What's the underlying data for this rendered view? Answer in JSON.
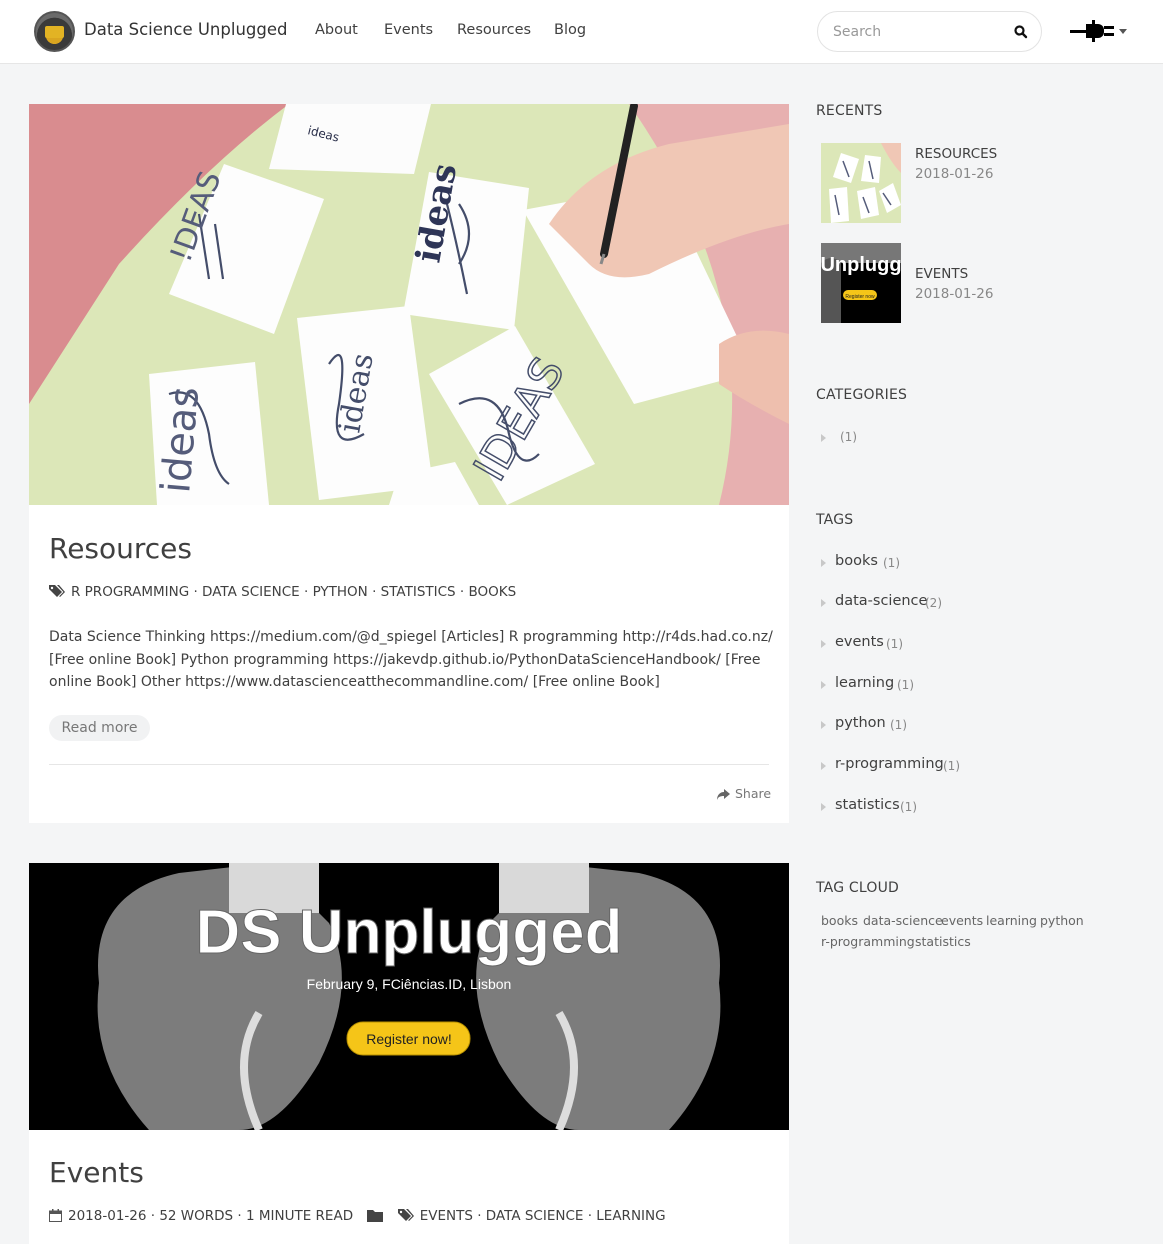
{
  "header": {
    "site_title": "Data Science Unplugged",
    "nav": [
      "About",
      "Events",
      "Resources",
      "Blog"
    ],
    "search_placeholder": "Search"
  },
  "posts": [
    {
      "title": "Resources",
      "tags": "R PROGRAMMING · DATA SCIENCE · PYTHON · STATISTICS · BOOKS",
      "excerpt": "Data Science Thinking https://medium.com/@d_spiegel [Articles] R programming http://r4ds.had.co.nz/ [Free online Book] Python programming https://jakevdp.github.io/PythonDataScienceHandbook/ [Free online Book] Other https://www.datascienceatthecommandline.com/ [Free online Book]",
      "read_more": "Read more",
      "share": "Share",
      "image_words": [
        "ideas",
        "!DEAS",
        "ideas",
        "ideas",
        "ideas",
        "IDEAS"
      ]
    },
    {
      "title": "Events",
      "meta": "2018-01-26 · 52 WORDS · 1 MINUTE READ",
      "tags": "EVENTS · DATA SCIENCE · LEARNING",
      "banner_title": "DS Unplugged",
      "banner_subtitle": "February 9, FCiências.ID, Lisbon",
      "banner_button": "Register now!"
    }
  ],
  "sidebar": {
    "recents_heading": "RECENTS",
    "recents": [
      {
        "title": "RESOURCES",
        "date": "2018-01-26"
      },
      {
        "title": "EVENTS",
        "date": "2018-01-26",
        "thumb_text": "Unplugg",
        "thumb_button": "Register now"
      }
    ],
    "categories_heading": "CATEGORIES",
    "categories": [
      {
        "name": "",
        "count": "(1)"
      }
    ],
    "tags_heading": "TAGS",
    "tags": [
      {
        "name": "books",
        "count": "(1)"
      },
      {
        "name": "data-science",
        "count": "(2)"
      },
      {
        "name": "events",
        "count": "(1)"
      },
      {
        "name": "learning",
        "count": "(1)"
      },
      {
        "name": "python",
        "count": "(1)"
      },
      {
        "name": "r-programming",
        "count": "(1)"
      },
      {
        "name": "statistics",
        "count": "(1)"
      }
    ],
    "tag_cloud_heading": "TAG CLOUD",
    "tag_cloud": [
      "books",
      "data-science",
      "events",
      "learning",
      "python",
      "r-programming",
      "statistics"
    ]
  },
  "colors": {
    "background": "#f4f5f6",
    "text": "#404040",
    "muted": "#888888",
    "banner_button": "#f5c518"
  }
}
